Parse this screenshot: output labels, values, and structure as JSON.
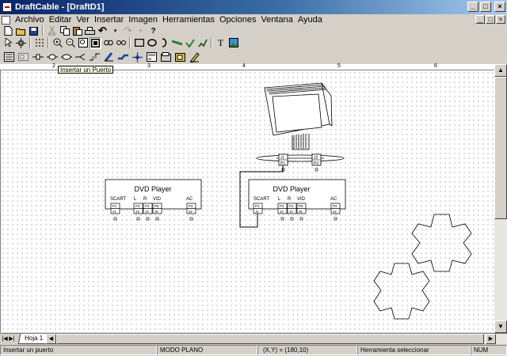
{
  "window": {
    "title": "DraftCable - [DraftD1]",
    "minimize": "_",
    "maximize": "□",
    "close": "×"
  },
  "menu": [
    "Archivo",
    "Editar",
    "Ver",
    "Insertar",
    "Imagen",
    "Herramientas",
    "Opciones",
    "Ventana",
    "Ayuda"
  ],
  "toolbar1": {
    "undo": "↶",
    "redo": "↷",
    "help": "?"
  },
  "toolbar2": {
    "text_tool": "T"
  },
  "tooltip": "Insertar un Puerto",
  "ruler": [
    "2",
    "3",
    "4",
    "5",
    "6"
  ],
  "canvas": {
    "devices": [
      {
        "name": "DVD Player",
        "labels": [
          "SCART",
          "L",
          "R",
          "VID",
          "AC"
        ],
        "ports": [
          [
            "P1",
            "J1"
          ],
          [
            "P3",
            "J3"
          ],
          [
            "P4",
            "J4"
          ],
          [
            "P5",
            "J5"
          ],
          [
            "P2",
            "J2"
          ]
        ]
      },
      {
        "name": "DVD Player",
        "labels": [
          "SCART",
          "L",
          "R",
          "VID",
          "AC"
        ],
        "ports": [
          [
            "P1",
            "J1"
          ],
          [
            "P3",
            "J3"
          ],
          [
            "P4",
            "J4"
          ],
          [
            "P5",
            "J5"
          ],
          [
            "P2",
            "J2"
          ]
        ]
      }
    ],
    "monitor_ports": [
      [
        "J1",
        "P1"
      ],
      [
        "J2",
        "P2"
      ]
    ]
  },
  "sheet_tab": "Hoja 1",
  "status": {
    "hint": "Insertar un puerto",
    "mode": "MODO PLANO",
    "coords": "(X,Y) = (180,10)",
    "tool": "Herramienta seleccionar",
    "num": "NUM"
  }
}
